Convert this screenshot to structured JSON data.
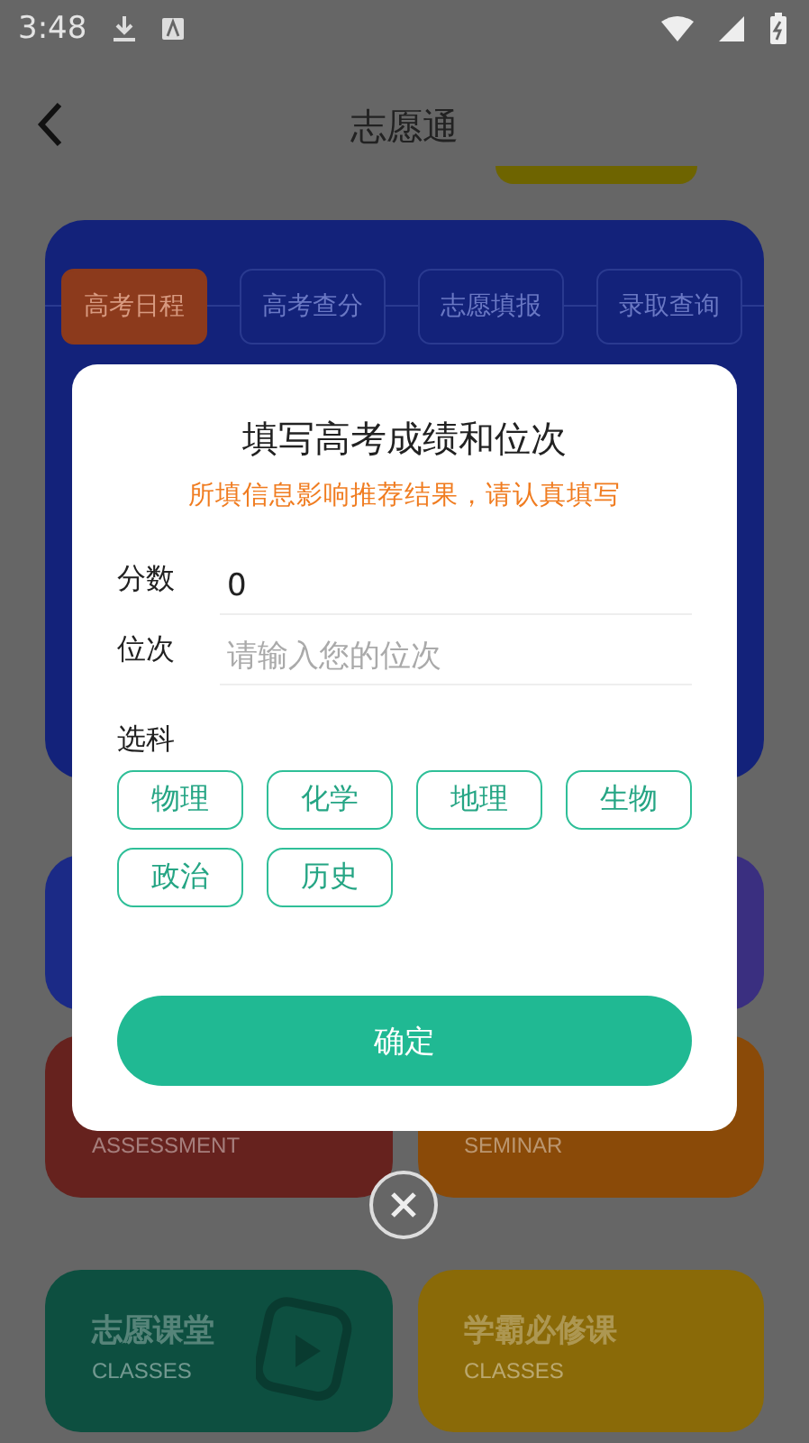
{
  "status_bar": {
    "time": "3:48"
  },
  "header": {
    "title": "志愿通"
  },
  "schedule_card": {
    "tabs": [
      {
        "label": "高考日程",
        "selected": true
      },
      {
        "label": "高考查分",
        "selected": false
      },
      {
        "label": "志愿填报",
        "selected": false
      },
      {
        "label": "录取查询",
        "selected": false
      }
    ]
  },
  "feature_cards": [
    {
      "color": "#1b2a86"
    },
    {
      "color": "#3a2f80"
    },
    {
      "subtitle": "ASSESSMENT",
      "color": "#66221e"
    },
    {
      "subtitle": "SEMINAR",
      "color": "#8a4a08"
    },
    {
      "title": "志愿课堂",
      "subtitle": "CLASSES",
      "color": "#0d4f40"
    },
    {
      "title": "学霸必修课",
      "subtitle": "CLASSES",
      "color": "#8a6a08"
    }
  ],
  "dialog": {
    "title": "填写高考成绩和位次",
    "notice": "所填信息影响推荐结果，请认真填写",
    "fields": [
      {
        "label": "分数",
        "value": "0"
      },
      {
        "label": "位次",
        "placeholder": "请输入您的位次"
      }
    ],
    "subjects_label": "选科",
    "subjects": [
      "物理",
      "化学",
      "地理",
      "生物",
      "政治",
      "历史"
    ],
    "confirm": "确定"
  }
}
